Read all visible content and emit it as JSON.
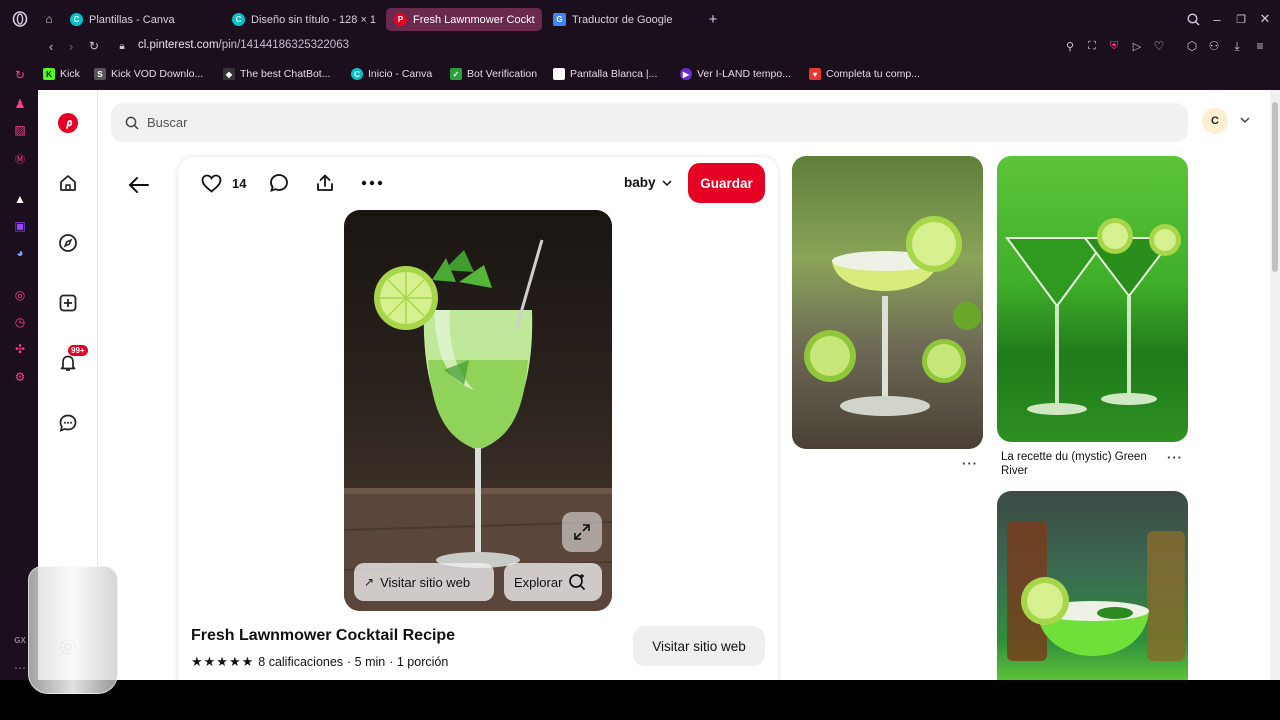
{
  "tabs": [
    {
      "label": "Plantillas - Canva",
      "icon": "canva-icon",
      "color": "#00c4cc"
    },
    {
      "label": "Diseño sin título - 128 × 1",
      "icon": "canva-icon",
      "color": "#00c4cc"
    },
    {
      "label": "Fresh Lawnmower Cockt",
      "icon": "pinterest-icon",
      "color": "#e60023"
    },
    {
      "label": "Traductor de Google",
      "icon": "google-translate-icon",
      "color": "#4285f4"
    }
  ],
  "address": {
    "host": "cl.pinterest.com",
    "path": "/pin/14144186325322063"
  },
  "bookmarks": [
    {
      "label": "Kick",
      "color": "#53fc18"
    },
    {
      "label": "Kick VOD Downlo...",
      "color": "#8a8a8a"
    },
    {
      "label": "The best ChatBot...",
      "color": "#444444"
    },
    {
      "label": "Inicio - Canva",
      "color": "#00c4cc"
    },
    {
      "label": "Bot Verification",
      "color": "#2e9e3e"
    },
    {
      "label": "Pantalla Blanca |...",
      "color": "#ffffff"
    },
    {
      "label": "Ver I-LAND tempo...",
      "color": "#6a2ccf"
    },
    {
      "label": "Completa tu comp...",
      "color": "#e33a2d"
    }
  ],
  "search": {
    "placeholder": "Buscar"
  },
  "user": {
    "initial": "C"
  },
  "notifications": {
    "badge": "99+"
  },
  "pin": {
    "likes": "14",
    "board": "baby",
    "save_label": "Guardar",
    "visit_label": "Visitar sitio web",
    "explore_label": "Explorar",
    "title": "Fresh Lawnmower Cocktail Recipe",
    "rating_text": "8 calificaciones",
    "time": "· 5 min",
    "portions": "· 1 porción",
    "visit_button": "Visitar sitio web"
  },
  "related": [
    {
      "caption": ""
    },
    {
      "caption": "La recette du (mystic) Green River"
    }
  ],
  "opera": {
    "gx_label": "GX"
  }
}
